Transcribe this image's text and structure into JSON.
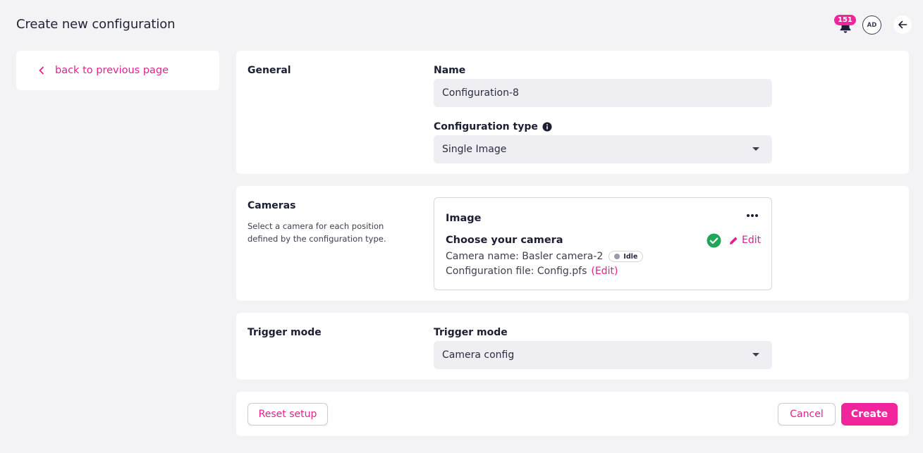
{
  "header": {
    "title": "Create new configuration",
    "notifications_count": "151",
    "avatar_initials": "AD"
  },
  "sidebar": {
    "back_label": "back to previous page"
  },
  "general": {
    "title": "General",
    "name_label": "Name",
    "name_value": "Configuration-8",
    "type_label": "Configuration type",
    "type_value": "Single Image"
  },
  "cameras": {
    "title": "Cameras",
    "description": "Select a camera for each position defined by the configuration type.",
    "box_title": "Image",
    "choose_label": "Choose your camera",
    "camera_name": "Camera name: Basler camera-2",
    "status": "Idle",
    "config_file": "Configuration file: Config.pfs",
    "config_edit": "(Edit)",
    "edit_label": "Edit"
  },
  "trigger": {
    "title": "Trigger mode",
    "field_label": "Trigger mode",
    "value": "Camera config"
  },
  "footer": {
    "reset_label": "Reset setup",
    "cancel_label": "Cancel",
    "create_label": "Create"
  },
  "colors": {
    "accent": "#f0259b",
    "success": "#22a559",
    "background": "#f3f3f6"
  }
}
